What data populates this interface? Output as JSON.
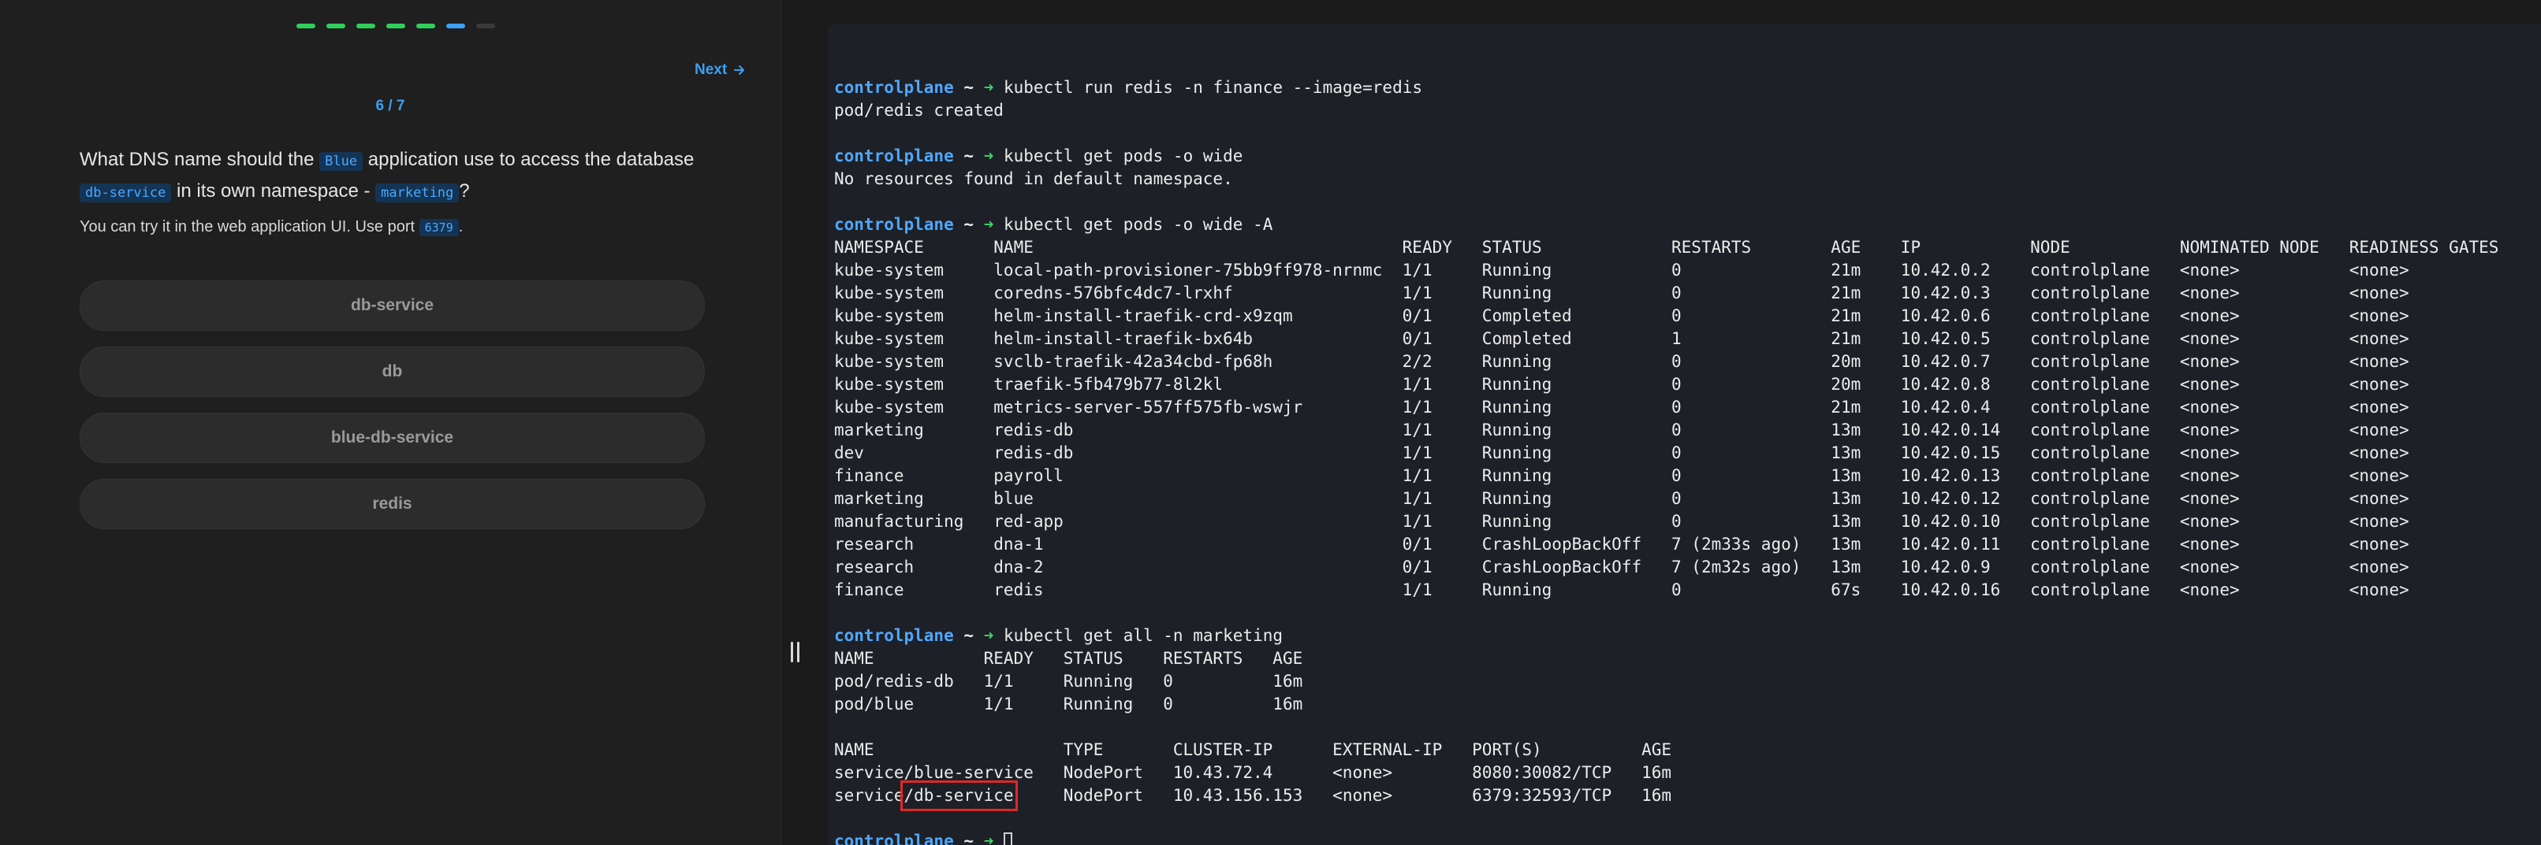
{
  "quiz": {
    "next_label": "Next",
    "counter": "6 / 7",
    "question": {
      "part1": "What DNS name should the ",
      "code1": "Blue",
      "part2": " application use to access the database ",
      "code2": "db-service",
      "part3": " in its own namespace - ",
      "code3": "marketing",
      "part4": "?"
    },
    "hint": {
      "part1": "You can try it in the web application UI. Use port ",
      "code": "6379",
      "part2": "."
    },
    "options": [
      "db-service",
      "db",
      "blue-db-service",
      "redis"
    ],
    "progress": {
      "total": 7,
      "current": 6,
      "colors": [
        "#2fcf5a",
        "#2fcf5a",
        "#2fcf5a",
        "#2fcf5a",
        "#2fcf5a",
        "#3aa0f2",
        "#3a3a3a"
      ]
    }
  },
  "terminal": {
    "prompt": {
      "host": "controlplane",
      "tilde": "~",
      "arrow": "➜"
    },
    "lines": [
      {
        "type": "blank"
      },
      {
        "type": "cmd",
        "text": "kubectl run redis -n finance --image=redis"
      },
      {
        "type": "out",
        "text": "pod/redis created"
      },
      {
        "type": "blank"
      },
      {
        "type": "cmd",
        "text": "kubectl get pods -o wide"
      },
      {
        "type": "out",
        "text": "No resources found in default namespace."
      },
      {
        "type": "blank"
      },
      {
        "type": "cmd",
        "text": "kubectl get pods -o wide -A"
      },
      {
        "type": "out",
        "text": "NAMESPACE       NAME                                     READY   STATUS             RESTARTS        AGE    IP           NODE           NOMINATED NODE   READINESS GATES"
      },
      {
        "type": "out",
        "text": "kube-system     local-path-provisioner-75bb9ff978-nrnmc  1/1     Running            0               21m    10.42.0.2    controlplane   <none>           <none>"
      },
      {
        "type": "out",
        "text": "kube-system     coredns-576bfc4dc7-lrxhf                 1/1     Running            0               21m    10.42.0.3    controlplane   <none>           <none>"
      },
      {
        "type": "out",
        "text": "kube-system     helm-install-traefik-crd-x9zqm           0/1     Completed          0               21m    10.42.0.6    controlplane   <none>           <none>"
      },
      {
        "type": "out",
        "text": "kube-system     helm-install-traefik-bx64b               0/1     Completed          1               21m    10.42.0.5    controlplane   <none>           <none>"
      },
      {
        "type": "out",
        "text": "kube-system     svclb-traefik-42a34cbd-fp68h             2/2     Running            0               20m    10.42.0.7    controlplane   <none>           <none>"
      },
      {
        "type": "out",
        "text": "kube-system     traefik-5fb479b77-8l2kl                  1/1     Running            0               20m    10.42.0.8    controlplane   <none>           <none>"
      },
      {
        "type": "out",
        "text": "kube-system     metrics-server-557ff575fb-wswjr          1/1     Running            0               21m    10.42.0.4    controlplane   <none>           <none>"
      },
      {
        "type": "out",
        "text": "marketing       redis-db                                 1/1     Running            0               13m    10.42.0.14   controlplane   <none>           <none>"
      },
      {
        "type": "out",
        "text": "dev             redis-db                                 1/1     Running            0               13m    10.42.0.15   controlplane   <none>           <none>"
      },
      {
        "type": "out",
        "text": "finance         payroll                                  1/1     Running            0               13m    10.42.0.13   controlplane   <none>           <none>"
      },
      {
        "type": "out",
        "text": "marketing       blue                                     1/1     Running            0               13m    10.42.0.12   controlplane   <none>           <none>"
      },
      {
        "type": "out",
        "text": "manufacturing   red-app                                  1/1     Running            0               13m    10.42.0.10   controlplane   <none>           <none>"
      },
      {
        "type": "out",
        "text": "research        dna-1                                    0/1     CrashLoopBackOff   7 (2m33s ago)   13m    10.42.0.11   controlplane   <none>           <none>"
      },
      {
        "type": "out",
        "text": "research        dna-2                                    0/1     CrashLoopBackOff   7 (2m32s ago)   13m    10.42.0.9    controlplane   <none>           <none>"
      },
      {
        "type": "out",
        "text": "finance         redis                                    1/1     Running            0               67s    10.42.0.16   controlplane   <none>           <none>"
      },
      {
        "type": "blank"
      },
      {
        "type": "cmd",
        "text": "kubectl get all -n marketing"
      },
      {
        "type": "out",
        "text": "NAME           READY   STATUS    RESTARTS   AGE"
      },
      {
        "type": "out",
        "text": "pod/redis-db   1/1     Running   0          16m"
      },
      {
        "type": "out",
        "text": "pod/blue       1/1     Running   0          16m"
      },
      {
        "type": "blank"
      },
      {
        "type": "out",
        "text": "NAME                   TYPE       CLUSTER-IP      EXTERNAL-IP   PORT(S)          AGE"
      },
      {
        "type": "out",
        "text": "service/blue-service   NodePort   10.43.72.4      <none>        8080:30082/TCP   16m"
      },
      {
        "type": "hl",
        "pre": "service",
        "mark": "/db-service",
        "post": "     NodePort   10.43.156.153   <none>        6379:32593/TCP   16m"
      },
      {
        "type": "blank"
      },
      {
        "type": "prompt-only"
      }
    ]
  },
  "colors": {
    "accent": "#3aa0f2",
    "prompt_host": "#4ea7ff",
    "prompt_arrow": "#3fd46a",
    "highlight": "#e02828"
  }
}
